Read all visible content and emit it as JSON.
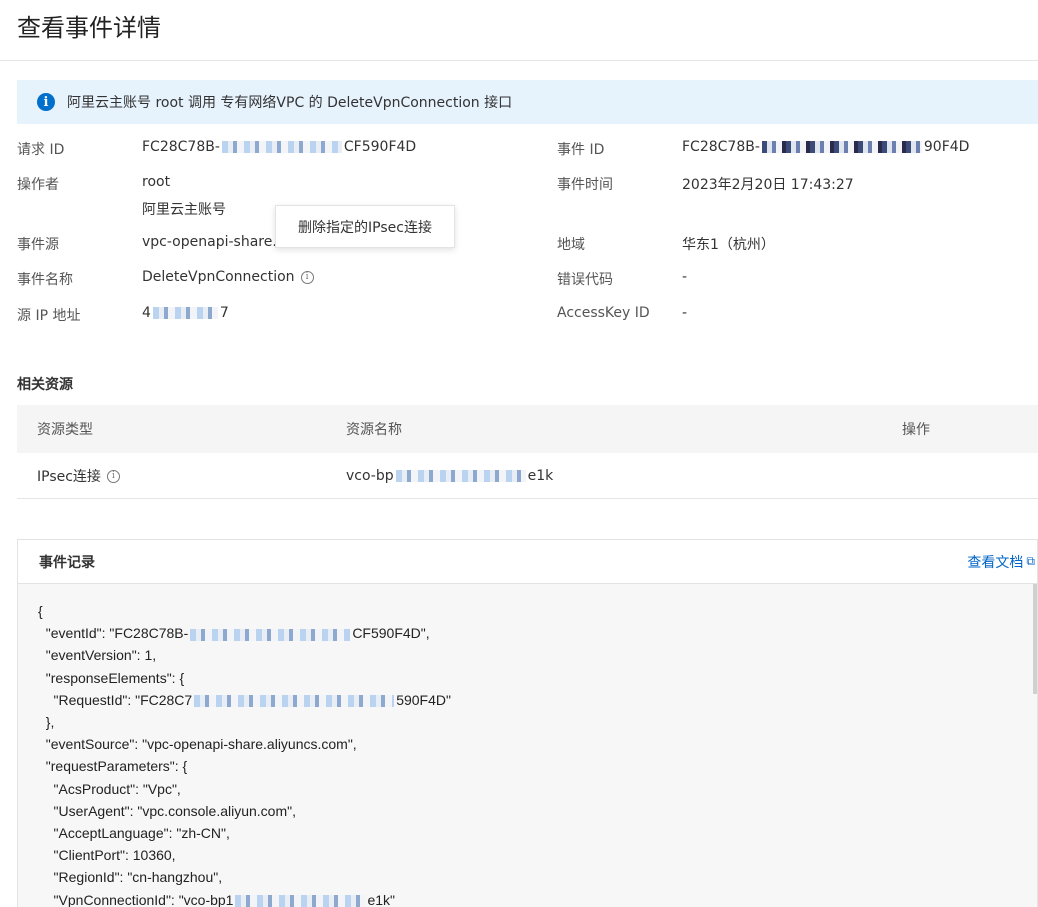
{
  "page": {
    "title": "查看事件详情"
  },
  "banner": {
    "text": "阿里云主账号 root 调用 专有网络VPC 的 DeleteVpnConnection 接口"
  },
  "details": {
    "request_id_label": "请求 ID",
    "request_id_prefix": "FC28C78B-",
    "request_id_suffix": "CF590F4D",
    "operator_label": "操作者",
    "operator_name": "root",
    "operator_type": "阿里云主账号",
    "event_source_label": "事件源",
    "event_source_value": "vpc-openapi-share.a",
    "event_name_label": "事件名称",
    "event_name_value": "DeleteVpnConnection",
    "source_ip_label": "源 IP 地址",
    "source_ip_prefix": "4",
    "source_ip_suffix": "7",
    "event_id_label": "事件 ID",
    "event_id_prefix": "FC28C78B-",
    "event_id_suffix": "90F4D",
    "event_time_label": "事件时间",
    "event_time_value": "2023年2月20日 17:43:27",
    "region_label": "地域",
    "region_value": "华东1（杭州）",
    "error_code_label": "错误代码",
    "error_code_value": "-",
    "accesskey_label": "AccessKey ID",
    "accesskey_value": "-"
  },
  "tooltip": {
    "text": "删除指定的IPsec连接"
  },
  "resources": {
    "title": "相关资源",
    "columns": [
      "资源类型",
      "资源名称",
      "操作"
    ],
    "rows": [
      {
        "type": "IPsec连接",
        "name_prefix": "vco-bp",
        "name_suffix": "e1k"
      }
    ]
  },
  "record": {
    "title": "事件记录",
    "doc_link": "查看文档",
    "lines": [
      "{",
      "  \"eventId\": \"FC28C78B-",
      "  \"eventVersion\": 1,",
      "  \"responseElements\": {",
      "    \"RequestId\": \"FC28C7",
      "  },",
      "  \"eventSource\": \"vpc-openapi-share.aliyuncs.com\",",
      "  \"requestParameters\": {",
      "    \"AcsProduct\": \"Vpc\",",
      "    \"UserAgent\": \"vpc.console.aliyun.com\",",
      "    \"AcceptLanguage\": \"zh-CN\",",
      "    \"ClientPort\": 10360,",
      "    \"RegionId\": \"cn-hangzhou\",",
      "    \"VpnConnectionId\": \"vco-bp1"
    ],
    "line_suffixes": [
      "",
      "CF590F4D\",",
      "",
      "",
      "590F4D\"",
      "",
      "",
      "",
      "",
      "",
      "",
      "",
      "",
      "e1k\""
    ]
  },
  "colors": {
    "accent": "#0064c8",
    "banner_bg": "#e6f2fc",
    "info_icon": "#0070cc"
  },
  "icons": {
    "banner": "info-icon",
    "help": "info-circle-icon",
    "external": "external-link-icon"
  }
}
